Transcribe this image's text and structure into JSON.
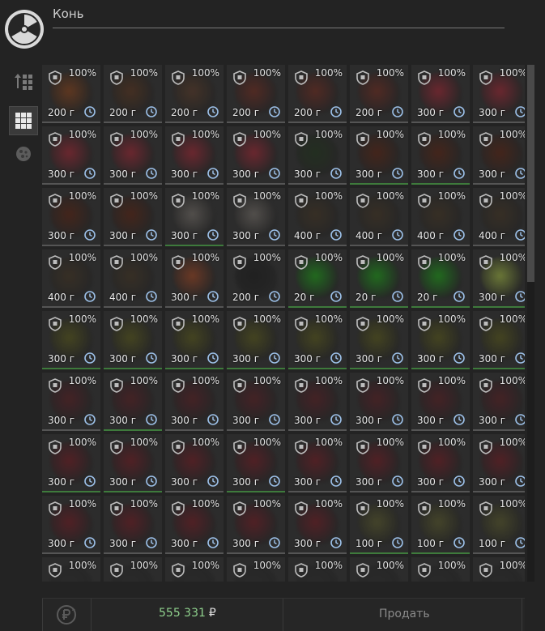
{
  "header": {
    "title": "Конь"
  },
  "sidebar": {
    "buttons": [
      {
        "name": "sort-button",
        "icon": "sort-icon"
      },
      {
        "name": "grid-view-button",
        "icon": "grid-icon",
        "active": true
      },
      {
        "name": "filter-button",
        "icon": "meat-icon"
      }
    ]
  },
  "items": [
    {
      "pct": "100%",
      "weight": "200 г",
      "color": "#6a3a1e"
    },
    {
      "pct": "100%",
      "weight": "200 г",
      "color": "#4a3020"
    },
    {
      "pct": "100%",
      "weight": "200 г",
      "color": "#4a3428"
    },
    {
      "pct": "100%",
      "weight": "200 г",
      "color": "#5a2a22"
    },
    {
      "pct": "100%",
      "weight": "200 г",
      "color": "#5a2a22"
    },
    {
      "pct": "100%",
      "weight": "200 г",
      "color": "#5a2a22"
    },
    {
      "pct": "100%",
      "weight": "300 г",
      "color": "#7a2630"
    },
    {
      "pct": "100%",
      "weight": "300 г",
      "color": "#7a2630"
    },
    {
      "pct": "100%",
      "weight": "300 г",
      "color": "#7a2630"
    },
    {
      "pct": "100%",
      "weight": "300 г",
      "color": "#7a2630"
    },
    {
      "pct": "100%",
      "weight": "300 г",
      "color": "#7a2630"
    },
    {
      "pct": "100%",
      "weight": "300 г",
      "color": "#7a2630"
    },
    {
      "pct": "100%",
      "weight": "300 г",
      "color": "#22301e"
    },
    {
      "pct": "100%",
      "weight": "300 г",
      "color": "#4a2418",
      "fresh": true
    },
    {
      "pct": "100%",
      "weight": "300 г",
      "color": "#4a2418",
      "fresh": true
    },
    {
      "pct": "100%",
      "weight": "300 г",
      "color": "#4a2418"
    },
    {
      "pct": "100%",
      "weight": "300 г",
      "color": "#4a2418"
    },
    {
      "pct": "100%",
      "weight": "300 г",
      "color": "#4a2418"
    },
    {
      "pct": "100%",
      "weight": "300 г",
      "color": "#5c5854",
      "fresh": true
    },
    {
      "pct": "100%",
      "weight": "300 г",
      "color": "#5c5854"
    },
    {
      "pct": "100%",
      "weight": "400 г",
      "color": "#3a3024"
    },
    {
      "pct": "100%",
      "weight": "400 г",
      "color": "#3a3024"
    },
    {
      "pct": "100%",
      "weight": "400 г",
      "color": "#3a3024"
    },
    {
      "pct": "100%",
      "weight": "400 г",
      "color": "#3a3024"
    },
    {
      "pct": "100%",
      "weight": "400 г",
      "color": "#3a3024"
    },
    {
      "pct": "100%",
      "weight": "400 г",
      "color": "#3a3024"
    },
    {
      "pct": "100%",
      "weight": "300 г",
      "color": "#7a3c24"
    },
    {
      "pct": "100%",
      "weight": "200 г",
      "color": "#1e1e1e"
    },
    {
      "pct": "100%",
      "weight": "20 г",
      "color": "#1f7a1c",
      "fresh": true
    },
    {
      "pct": "100%",
      "weight": "20 г",
      "color": "#1f7a1c",
      "fresh": true
    },
    {
      "pct": "100%",
      "weight": "20 г",
      "color": "#1f7a1c",
      "fresh": true
    },
    {
      "pct": "100%",
      "weight": "300 г",
      "color": "#7a8a3a",
      "fresh": true
    },
    {
      "pct": "100%",
      "weight": "300 г",
      "color": "#4a4a1e",
      "fresh": true
    },
    {
      "pct": "100%",
      "weight": "300 г",
      "color": "#4a4a1e",
      "fresh": true
    },
    {
      "pct": "100%",
      "weight": "300 г",
      "color": "#4a4a1e",
      "fresh": true
    },
    {
      "pct": "100%",
      "weight": "300 г",
      "color": "#4a4a1e",
      "fresh": true
    },
    {
      "pct": "100%",
      "weight": "300 г",
      "color": "#4a4a1e",
      "fresh": true
    },
    {
      "pct": "100%",
      "weight": "300 г",
      "color": "#4a4a1e",
      "fresh": true
    },
    {
      "pct": "100%",
      "weight": "300 г",
      "color": "#4a4a1e",
      "fresh": true
    },
    {
      "pct": "100%",
      "weight": "300 г",
      "color": "#4a4a1e",
      "fresh": true
    },
    {
      "pct": "100%",
      "weight": "300 г",
      "color": "#4a2024"
    },
    {
      "pct": "100%",
      "weight": "300 г",
      "color": "#4a2024",
      "fresh": true
    },
    {
      "pct": "100%",
      "weight": "300 г",
      "color": "#4a2024"
    },
    {
      "pct": "100%",
      "weight": "300 г",
      "color": "#4a2024"
    },
    {
      "pct": "100%",
      "weight": "300 г",
      "color": "#4a2024"
    },
    {
      "pct": "100%",
      "weight": "300 г",
      "color": "#4a2024"
    },
    {
      "pct": "100%",
      "weight": "300 г",
      "color": "#4a2024"
    },
    {
      "pct": "100%",
      "weight": "300 г",
      "color": "#4a2024"
    },
    {
      "pct": "100%",
      "weight": "300 г",
      "color": "#5a1e24",
      "fresh": true
    },
    {
      "pct": "100%",
      "weight": "300 г",
      "color": "#5a1e24",
      "fresh": true
    },
    {
      "pct": "100%",
      "weight": "300 г",
      "color": "#5a1e24"
    },
    {
      "pct": "100%",
      "weight": "300 г",
      "color": "#5a1e24",
      "fresh": true
    },
    {
      "pct": "100%",
      "weight": "300 г",
      "color": "#5a1e24"
    },
    {
      "pct": "100%",
      "weight": "300 г",
      "color": "#5a1e24"
    },
    {
      "pct": "100%",
      "weight": "300 г",
      "color": "#5a1e24"
    },
    {
      "pct": "100%",
      "weight": "300 г",
      "color": "#5a1e24"
    },
    {
      "pct": "100%",
      "weight": "300 г",
      "color": "#5a1e24"
    },
    {
      "pct": "100%",
      "weight": "300 г",
      "color": "#5a1e24"
    },
    {
      "pct": "100%",
      "weight": "300 г",
      "color": "#5a1e24"
    },
    {
      "pct": "100%",
      "weight": "300 г",
      "color": "#5a1e24"
    },
    {
      "pct": "100%",
      "weight": "300 г",
      "color": "#5a1e24"
    },
    {
      "pct": "100%",
      "weight": "100 г",
      "color": "#4a4a2a",
      "fresh": true
    },
    {
      "pct": "100%",
      "weight": "100 г",
      "color": "#4a4a2a",
      "fresh": true
    },
    {
      "pct": "100%",
      "weight": "100 г",
      "color": "#4a4a2a"
    },
    {
      "pct": "100%",
      "weight": "",
      "color": "#2a2a2a",
      "fresh": true
    },
    {
      "pct": "100%",
      "weight": "",
      "color": "#2a2a2a"
    },
    {
      "pct": "100%",
      "weight": "",
      "color": "#2a2a2a",
      "fresh": true
    },
    {
      "pct": "100%",
      "weight": "",
      "color": "#2a2a2a"
    },
    {
      "pct": "100%",
      "weight": "",
      "color": "#2a2a2a"
    },
    {
      "pct": "100%",
      "weight": "",
      "color": "#2a2a2a"
    },
    {
      "pct": "100%",
      "weight": "",
      "color": "#2a2a2a"
    },
    {
      "pct": "100%",
      "weight": "",
      "color": "#2a2a2a"
    }
  ],
  "footer": {
    "balance_value": "555 331",
    "currency": "₽",
    "sell_label": "Продать",
    "balance_color": "#8fd18d"
  }
}
